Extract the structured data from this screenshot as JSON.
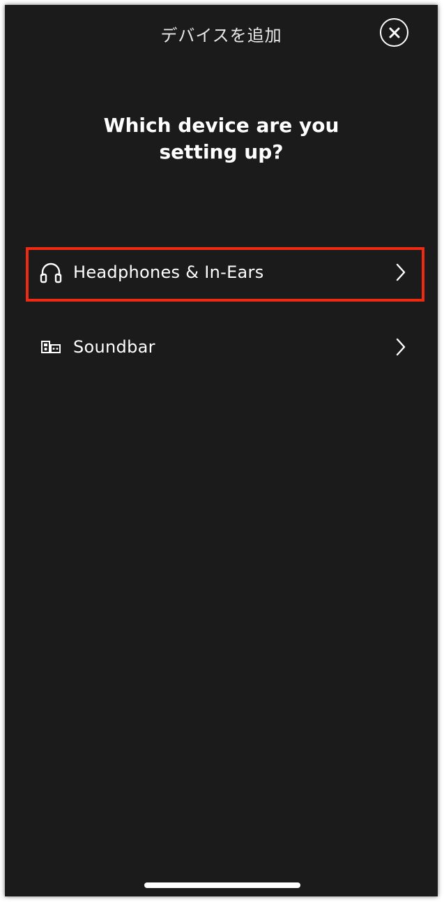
{
  "header": {
    "title": "デバイスを追加",
    "close_icon": "close-circle-icon"
  },
  "main": {
    "heading_line1": "Which device are you",
    "heading_line2": "setting up?",
    "devices": [
      {
        "label": "Headphones & In-Ears",
        "icon": "headphones-icon",
        "highlighted": true
      },
      {
        "label": "Soundbar",
        "icon": "soundbar-icon",
        "highlighted": false
      }
    ]
  },
  "colors": {
    "background": "#1b1b1b",
    "text": "#ffffff",
    "highlight": "#ee2a12"
  }
}
